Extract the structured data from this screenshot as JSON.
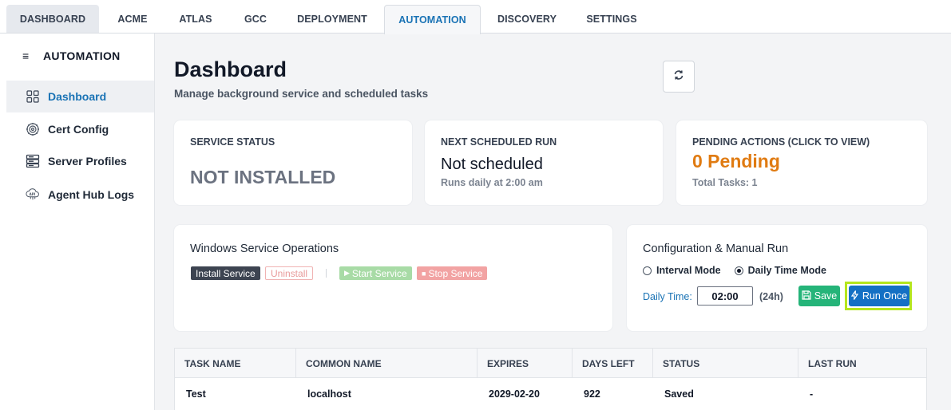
{
  "tabs": [
    "DASHBOARD",
    "ACME",
    "ATLAS",
    "GCC",
    "DEPLOYMENT",
    "AUTOMATION",
    "DISCOVERY",
    "SETTINGS"
  ],
  "sidebar": {
    "title": "AUTOMATION",
    "items": [
      {
        "label": "Dashboard",
        "icon": "grid-icon"
      },
      {
        "label": "Cert Config",
        "icon": "gear-cert-icon"
      },
      {
        "label": "Server Profiles",
        "icon": "server-icon"
      },
      {
        "label": "Agent Hub Logs",
        "icon": "api-logs-icon"
      }
    ]
  },
  "header": {
    "title": "Dashboard",
    "subtitle": "Manage background service and scheduled tasks"
  },
  "stats": {
    "service_status": {
      "label": "SERVICE STATUS",
      "value": "NOT INSTALLED"
    },
    "next_run": {
      "label": "NEXT SCHEDULED RUN",
      "value": "Not scheduled",
      "sub": "Runs daily at 2:00 am"
    },
    "pending": {
      "label": "PENDING ACTIONS (CLICK TO VIEW)",
      "value": "0 Pending",
      "sub": "Total Tasks: 1"
    }
  },
  "service_ops": {
    "title": "Windows Service Operations",
    "install": "Install Service",
    "uninstall": "Uninstall",
    "start": "Start Service",
    "stop": "Stop Service"
  },
  "config": {
    "title": "Configuration & Manual Run",
    "interval_mode": "Interval Mode",
    "daily_mode": "Daily Time Mode",
    "selected_mode": "Daily Time Mode",
    "daily_time_label": "Daily Time:",
    "daily_time_value": "02:00",
    "unit": "(24h)",
    "save": "Save",
    "run_once": "Run Once"
  },
  "table": {
    "columns": [
      "TASK NAME",
      "COMMON NAME",
      "EXPIRES",
      "DAYS LEFT",
      "STATUS",
      "LAST RUN"
    ],
    "rows": [
      [
        "Test",
        "localhost",
        "2029-02-20",
        "922",
        "Saved",
        "-"
      ]
    ]
  },
  "colors": {
    "accent": "#1a73b5",
    "pending": "#e07b12",
    "save": "#25b479",
    "run": "#1470c4",
    "highlight": "#b5e61d"
  }
}
